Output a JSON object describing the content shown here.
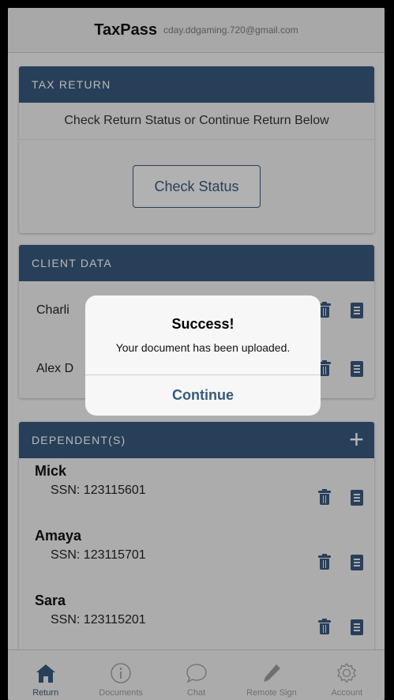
{
  "header": {
    "title": "TaxPass",
    "email": "cday.ddgaming.720@gmail.com"
  },
  "tax_return": {
    "heading": "TAX RETURN",
    "subtitle": "Check Return Status or Continue Return Below",
    "button": "Check Status"
  },
  "client_data": {
    "heading": "CLIENT DATA",
    "clients": [
      {
        "name": "Charli"
      },
      {
        "name": "Alex D"
      }
    ]
  },
  "dependents": {
    "heading": "DEPENDENT(S)",
    "add_label": "+",
    "items": [
      {
        "name": "Mick",
        "ssn": "SSN: 123115601"
      },
      {
        "name": "Amaya",
        "ssn": "SSN: 123115701"
      },
      {
        "name": "Sara",
        "ssn": "SSN: 123115201"
      }
    ]
  },
  "alert": {
    "title": "Success!",
    "message": "Your document has been uploaded.",
    "button": "Continue"
  },
  "tabs": [
    {
      "label": "Return",
      "icon": "home-icon",
      "active": true
    },
    {
      "label": "Documents",
      "icon": "info-icon",
      "active": false
    },
    {
      "label": "Chat",
      "icon": "chat-bubble-icon",
      "active": false
    },
    {
      "label": "Remote Sign",
      "icon": "pen-icon",
      "active": false
    },
    {
      "label": "Account",
      "icon": "gear-icon",
      "active": false
    }
  ],
  "colors": {
    "primary": "#38587c",
    "inactive": "#9a9a9a"
  }
}
